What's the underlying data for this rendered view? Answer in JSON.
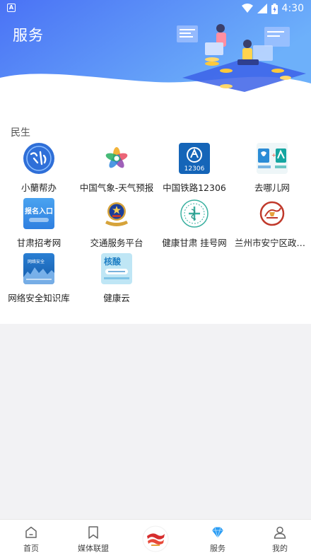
{
  "status_bar": {
    "time": "4:30",
    "left_icon": "A"
  },
  "header": {
    "title": "服务"
  },
  "section": {
    "title": "民生",
    "items": [
      {
        "label": "小蘭帮办",
        "icon": "xiaolan-logo-icon"
      },
      {
        "label": "中国气象-天气预报",
        "icon": "weather-logo-icon"
      },
      {
        "label": "中国铁路12306",
        "icon": "railway-12306-icon",
        "icon_text": "12306"
      },
      {
        "label": "去哪儿网",
        "icon": "qunar-logo-icon"
      },
      {
        "label": "甘肃招考网",
        "icon": "exam-logo-icon",
        "icon_text": "报名入口"
      },
      {
        "label": "交通服务平台",
        "icon": "police-emblem-icon"
      },
      {
        "label": "健康甘肃  挂号网",
        "icon": "health-gansu-icon"
      },
      {
        "label": "兰州市安宁区政务服务",
        "icon": "anning-logo-icon"
      },
      {
        "label": "网络安全知识库",
        "icon": "cyber-security-icon",
        "icon_text": "网络安全"
      },
      {
        "label": "健康云",
        "icon": "health-cloud-icon",
        "icon_text": "核酸"
      }
    ]
  },
  "bottom_nav": {
    "items": [
      {
        "label": "首页",
        "icon": "home-icon",
        "active": false
      },
      {
        "label": "媒体联盟",
        "icon": "bookmark-icon",
        "active": false
      },
      {
        "label": "",
        "icon": "center-logo-icon",
        "active": false
      },
      {
        "label": "服务",
        "icon": "diamond-icon",
        "active": true
      },
      {
        "label": "我的",
        "icon": "profile-icon",
        "active": false
      }
    ]
  },
  "colors": {
    "accent": "#2a9df4",
    "header_start": "#4f7cf7",
    "header_end": "#6aa8f9"
  }
}
